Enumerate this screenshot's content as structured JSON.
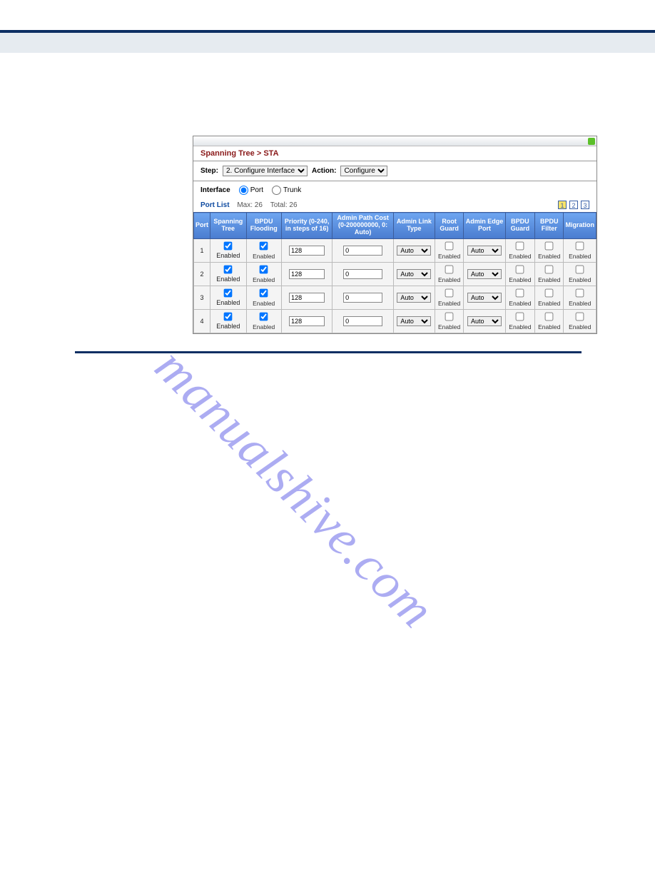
{
  "breadcrumb": "Spanning Tree > STA",
  "filters": {
    "step_label": "Step:",
    "step_value": "2. Configure Interface",
    "action_label": "Action:",
    "action_value": "Configure"
  },
  "interface": {
    "label": "Interface",
    "port_label": "Port",
    "trunk_label": "Trunk"
  },
  "portlist": {
    "label": "Port List",
    "max_label": "Max: 26",
    "total_label": "Total: 26",
    "pages": [
      "1",
      "2",
      "3"
    ]
  },
  "headers": {
    "port": "Port",
    "spanning": "Spanning Tree",
    "bpdu_flood": "BPDU Flooding",
    "priority": "Priority (0-240, in steps of 16)",
    "pathcost": "Admin Path Cost (0-200000000, 0: Auto)",
    "linktype": "Admin Link Type",
    "rootguard": "Root Guard",
    "edgeport": "Admin Edge Port",
    "bpdu_guard": "BPDU Guard",
    "bpdu_filter": "BPDU Filter",
    "migration": "Migration"
  },
  "cell_labels": {
    "enabled": "Enabled",
    "auto": "Auto"
  },
  "rows": [
    {
      "port": "1",
      "priority": "128",
      "pathcost": "0",
      "linktype": "Auto",
      "edgeport": "Auto"
    },
    {
      "port": "2",
      "priority": "128",
      "pathcost": "0",
      "linktype": "Auto",
      "edgeport": "Auto"
    },
    {
      "port": "3",
      "priority": "128",
      "pathcost": "0",
      "linktype": "Auto",
      "edgeport": "Auto"
    },
    {
      "port": "4",
      "priority": "128",
      "pathcost": "0",
      "linktype": "Auto",
      "edgeport": "Auto"
    }
  ],
  "watermark": "manualshive.com"
}
